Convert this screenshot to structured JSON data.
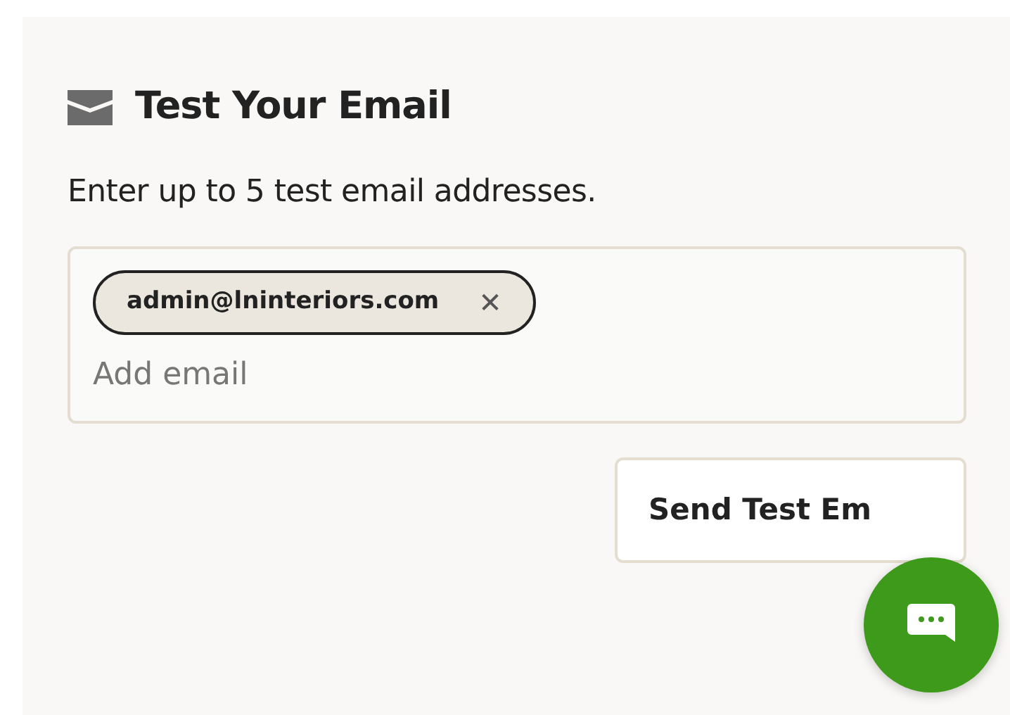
{
  "section": {
    "title": "Test Your Email",
    "description": "Enter up to 5 test email addresses."
  },
  "email_field": {
    "chips": [
      {
        "label": "admin@lninteriors.com",
        "remove": "✕"
      }
    ],
    "placeholder": "Add email"
  },
  "send_button": {
    "label": "Send Test Em"
  },
  "chat_button": {
    "color": "#3d9a1a"
  }
}
